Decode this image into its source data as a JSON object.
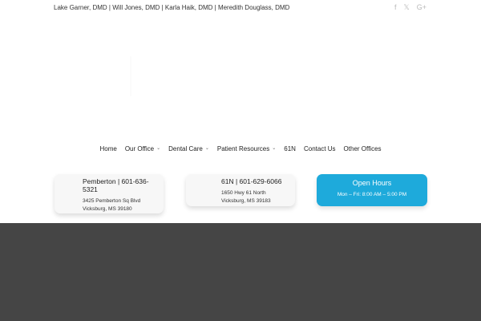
{
  "topbar": {
    "doctors": "Lake Garner, DMD | Will Jones, DMD | Karla Haik, DMD | Meredith Douglass, DMD",
    "social": {
      "facebook": "f",
      "twitter": "𝕏",
      "googleplus": "G+"
    }
  },
  "nav": {
    "items": [
      {
        "label": "Home",
        "dropdown": false
      },
      {
        "label": "Our Office",
        "dropdown": true
      },
      {
        "label": "Dental Care",
        "dropdown": true
      },
      {
        "label": "Patient Resources",
        "dropdown": true
      },
      {
        "label": "61N",
        "dropdown": false
      },
      {
        "label": "Contact Us",
        "dropdown": false
      },
      {
        "label": "Other Offices",
        "dropdown": false
      }
    ],
    "chevron": "⌄"
  },
  "cards": {
    "pemberton": {
      "title": "Pemberton | 601-636-5321",
      "address_line1": "3425 Pemberton Sq Blvd",
      "address_line2": "Vicksburg, MS 39180"
    },
    "n61": {
      "title": "61N | 601-629-6066",
      "address_line1": "1650 Hwy 61 North",
      "address_line2": "Vicksburg, MS 39183"
    },
    "hours": {
      "title": "Open Hours",
      "hours": "Mon – Fri: 8:00 AM – 5:00 PM"
    }
  },
  "colors": {
    "accent": "#1eaadb",
    "footer": "#454545",
    "card_bg": "#f7f7f7"
  }
}
